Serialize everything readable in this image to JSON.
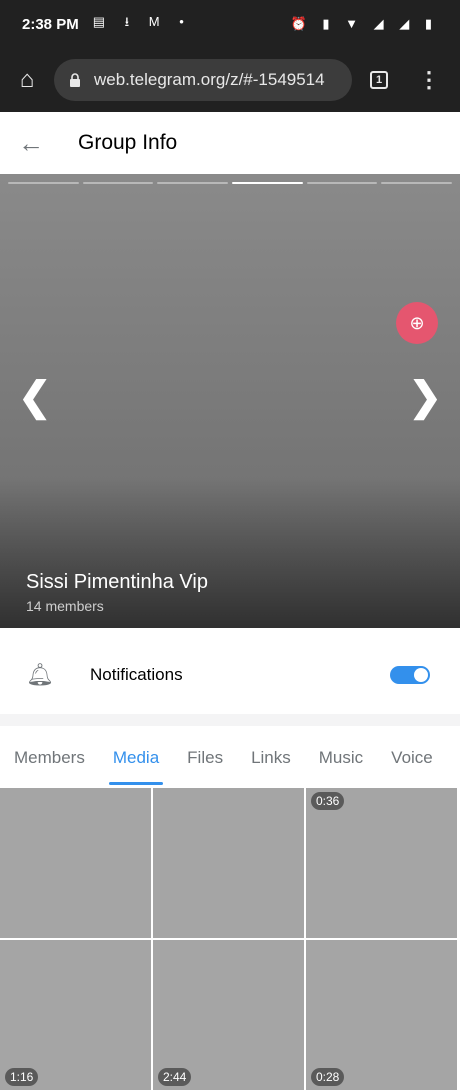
{
  "status": {
    "time": "2:38 PM"
  },
  "browser": {
    "url": "web.telegram.org/z/#-1549514",
    "tab_count": "1"
  },
  "header": {
    "title": "Group Info"
  },
  "profile": {
    "name": "Sissi Pimentinha Vip",
    "members": "14 members",
    "photo_count": 6,
    "active_photo": 4
  },
  "notifications": {
    "label": "Notifications",
    "enabled": true
  },
  "tabs": [
    "Members",
    "Media",
    "Files",
    "Links",
    "Music",
    "Voice"
  ],
  "active_tab": "Media",
  "media": [
    {
      "duration": ""
    },
    {
      "duration": ""
    },
    {
      "duration": "0:36"
    },
    {
      "duration": "1:16"
    },
    {
      "duration": "2:44"
    },
    {
      "duration": "0:28"
    }
  ],
  "colors": {
    "accent": "#3390ec",
    "zoom": "#e5566f"
  }
}
